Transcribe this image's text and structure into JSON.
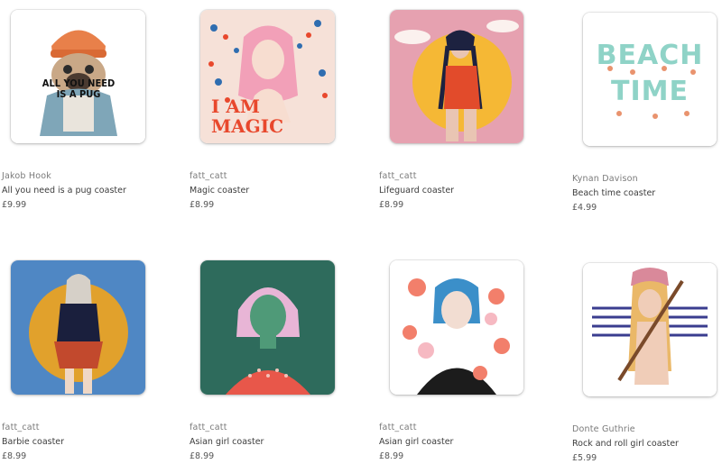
{
  "products": [
    {
      "seller": "Jakob Hook",
      "title": "All you need is a pug coaster",
      "price": "£9.99",
      "image_text": "ALL YOU NEED IS A PUG",
      "icon": "pug-illustration"
    },
    {
      "seller": "fatt_catt",
      "title": "Magic coaster",
      "price": "£8.99",
      "image_text": "I AM MAGIC",
      "icon": "pink-hair-girl-illustration"
    },
    {
      "seller": "fatt_catt",
      "title": "Lifeguard coaster",
      "price": "£8.99",
      "image_text": "",
      "icon": "lifeguard-girl-illustration"
    },
    {
      "seller": "Kynan Davison",
      "title": "Beach time coaster",
      "price": "£4.99",
      "image_text": "BEACH TIME",
      "icon": "beach-time-lettering"
    },
    {
      "seller": "fatt_catt",
      "title": "Barbie coaster",
      "price": "£8.99",
      "image_text": "",
      "icon": "barbie-girl-illustration"
    },
    {
      "seller": "fatt_catt",
      "title": "Asian girl coaster",
      "price": "£8.99",
      "image_text": "",
      "icon": "green-girl-illustration"
    },
    {
      "seller": "fatt_catt",
      "title": "Asian girl coaster",
      "price": "£8.99",
      "image_text": "",
      "icon": "flower-girl-illustration"
    },
    {
      "seller": "Donte Guthrie",
      "title": "Rock and roll girl coaster",
      "price": "£5.99",
      "image_text": "",
      "icon": "rock-girl-illustration"
    }
  ]
}
